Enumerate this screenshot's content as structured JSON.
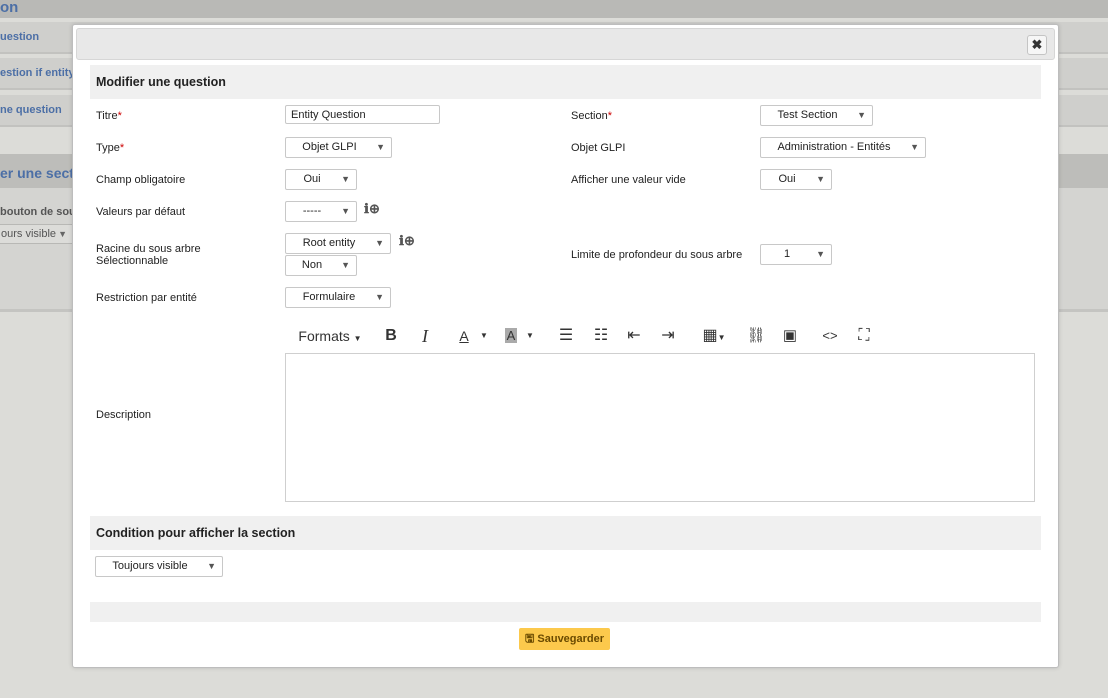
{
  "background": {
    "title_fragment": "on",
    "rows": [
      "uestion",
      "estion if entity",
      "ne question"
    ],
    "section_fragment": "er une sect",
    "button_fragment": "bouton de sou",
    "select_fragment": "ours visible"
  },
  "modal": {
    "header": "Modifier une question",
    "fields": {
      "titre_label": "Titre",
      "titre_value": "Entity Question",
      "section_label": "Section",
      "section_value": "Test Section",
      "type_label": "Type",
      "type_value": "Objet GLPI",
      "objet_label": "Objet GLPI",
      "objet_value": "Administration - Entités",
      "obligatoire_label": "Champ obligatoire",
      "obligatoire_value": "Oui",
      "vide_label": "Afficher une valeur vide",
      "vide_value": "Oui",
      "defaut_label": "Valeurs par défaut",
      "defaut_value": "-----",
      "racine_label": "Racine du sous arbre",
      "selectionnable_label": "Sélectionnable",
      "racine_value": "Root entity",
      "selectionnable_value": "Non",
      "profondeur_label": "Limite de profondeur du sous arbre",
      "profondeur_value": "1",
      "restriction_label": "Restriction par entité",
      "restriction_value": "Formulaire",
      "description_label": "Description",
      "required_mark": "*"
    },
    "editor_toolbar": {
      "formats_label": "Formats",
      "icons": [
        "bold-icon",
        "italic-icon",
        "text-color-icon",
        "background-color-icon",
        "bullet-list-icon",
        "numbered-list-icon",
        "outdent-icon",
        "indent-icon",
        "table-icon",
        "link-icon",
        "image-icon",
        "source-code-icon",
        "fullscreen-icon"
      ]
    },
    "condition_header": "Condition pour afficher la section",
    "condition_value": "Toujours visible",
    "save_label": "Sauvegarder",
    "info_icons": "ℹ⊕",
    "caret": "▼",
    "close_glyph": "✖"
  }
}
